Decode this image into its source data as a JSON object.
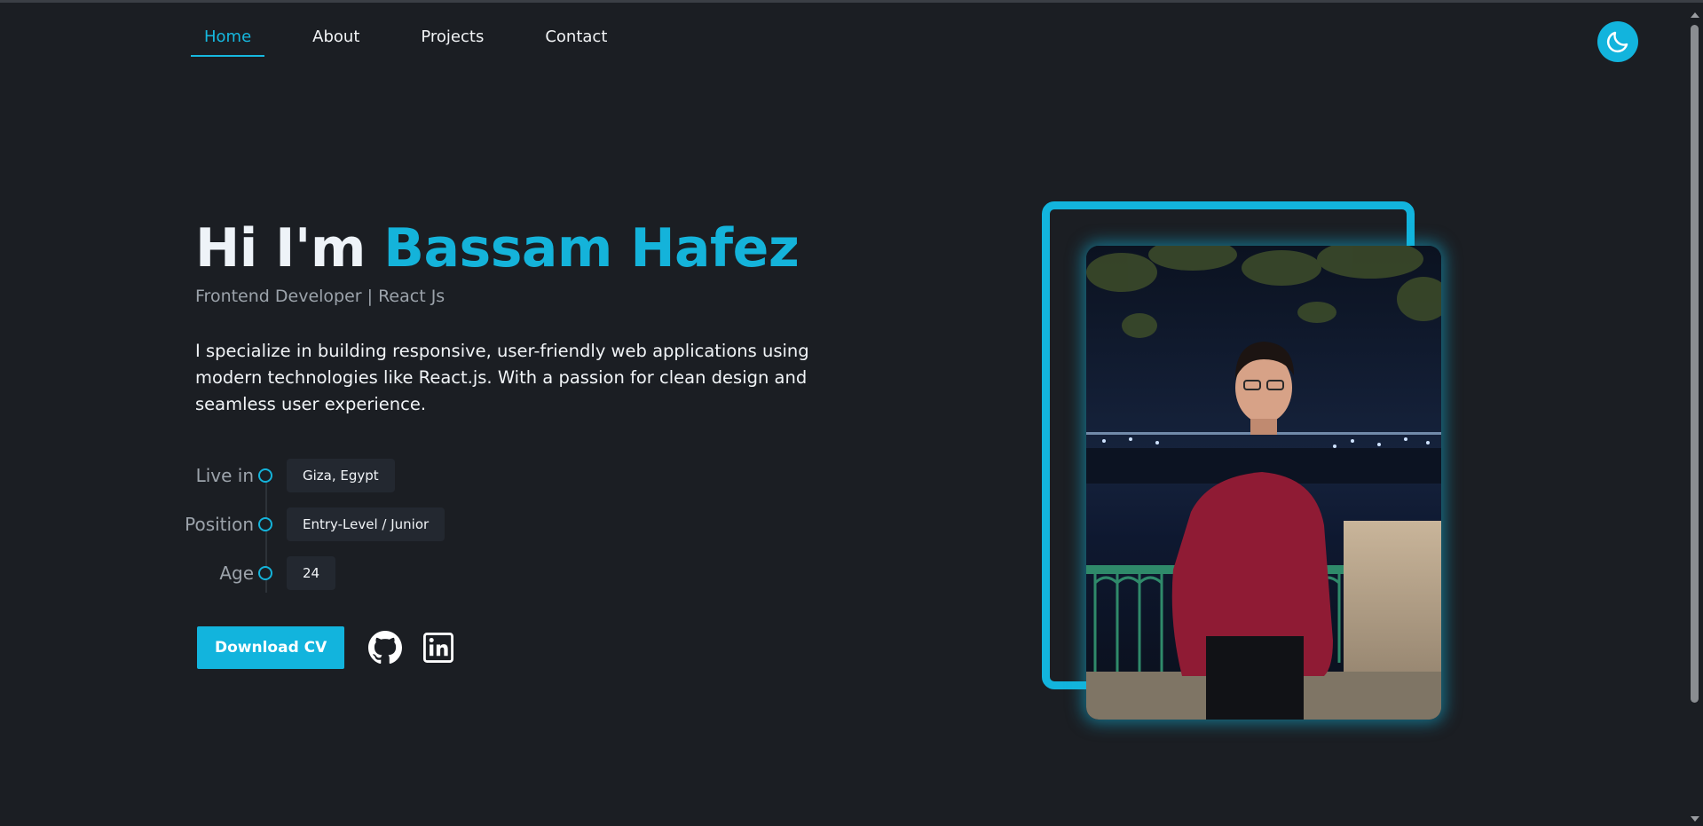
{
  "nav": {
    "items": [
      {
        "label": "Home",
        "active": true
      },
      {
        "label": "About",
        "active": false
      },
      {
        "label": "Projects",
        "active": false
      },
      {
        "label": "Contact",
        "active": false
      }
    ]
  },
  "theme_toggle": {
    "icon": "moon-icon",
    "color": "#12b4dd"
  },
  "hero": {
    "greeting": "Hi I'm",
    "name": "Bassam Hafez",
    "subtitle": "Frontend Developer | React Js",
    "description": "I specialize in building responsive, user-friendly web applications using modern technologies like React.js. With a passion for clean design and seamless user experience."
  },
  "info": [
    {
      "label": "Live in",
      "value": "Giza, Egypt"
    },
    {
      "label": "Position",
      "value": "Entry-Level / Junior"
    },
    {
      "label": "Age",
      "value": "24"
    }
  ],
  "actions": {
    "download_label": "Download CV",
    "social": [
      {
        "name": "github-icon"
      },
      {
        "name": "linkedin-icon"
      }
    ]
  },
  "colors": {
    "accent": "#12b4dd",
    "background": "#1b1e23",
    "chip": "#232830",
    "muted_text": "#9ca3ab"
  }
}
